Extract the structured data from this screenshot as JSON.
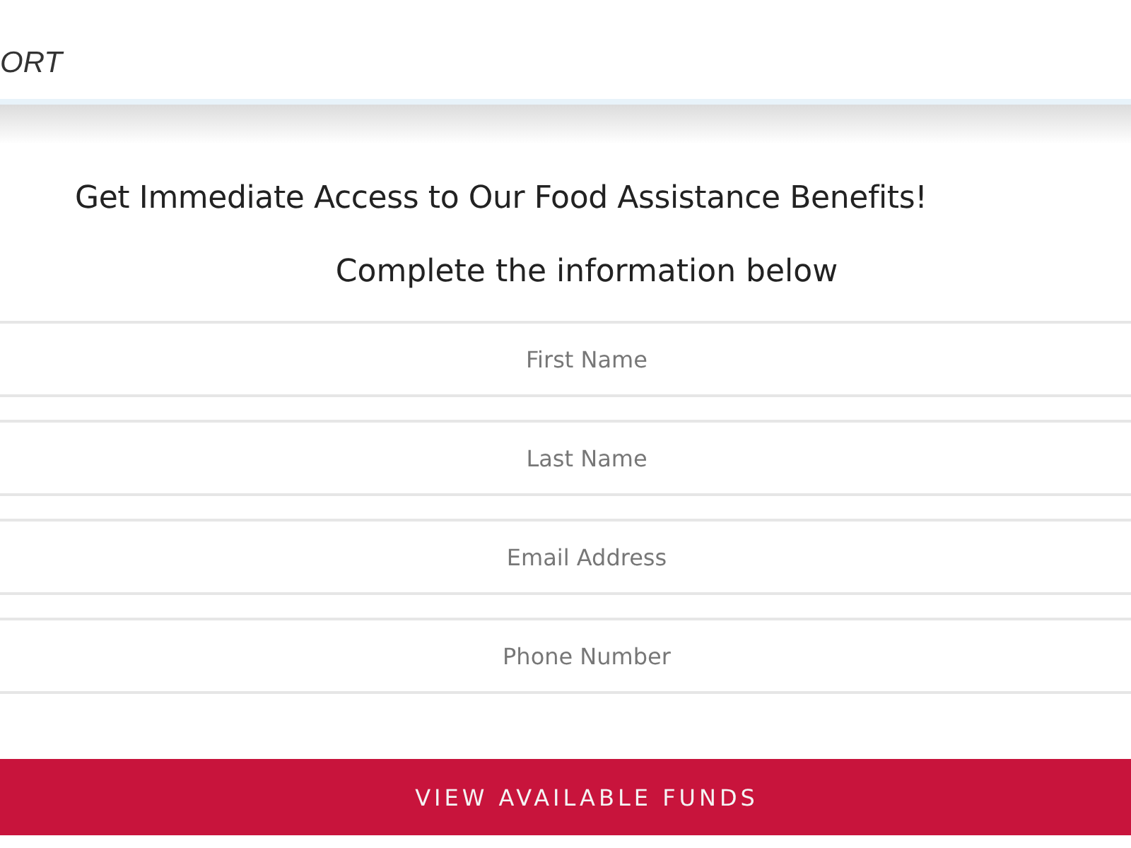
{
  "header": {
    "brand": "ORT"
  },
  "headline": "Get Immediate Access to Our Food Assistance Benefits!",
  "subheadline": "Complete the information below",
  "fields": [
    {
      "placeholder": "First Name"
    },
    {
      "placeholder": "Last Name"
    },
    {
      "placeholder": "Email Address"
    },
    {
      "placeholder": "Phone Number"
    }
  ],
  "submit_button": "VIEW AVAILABLE FUNDS"
}
